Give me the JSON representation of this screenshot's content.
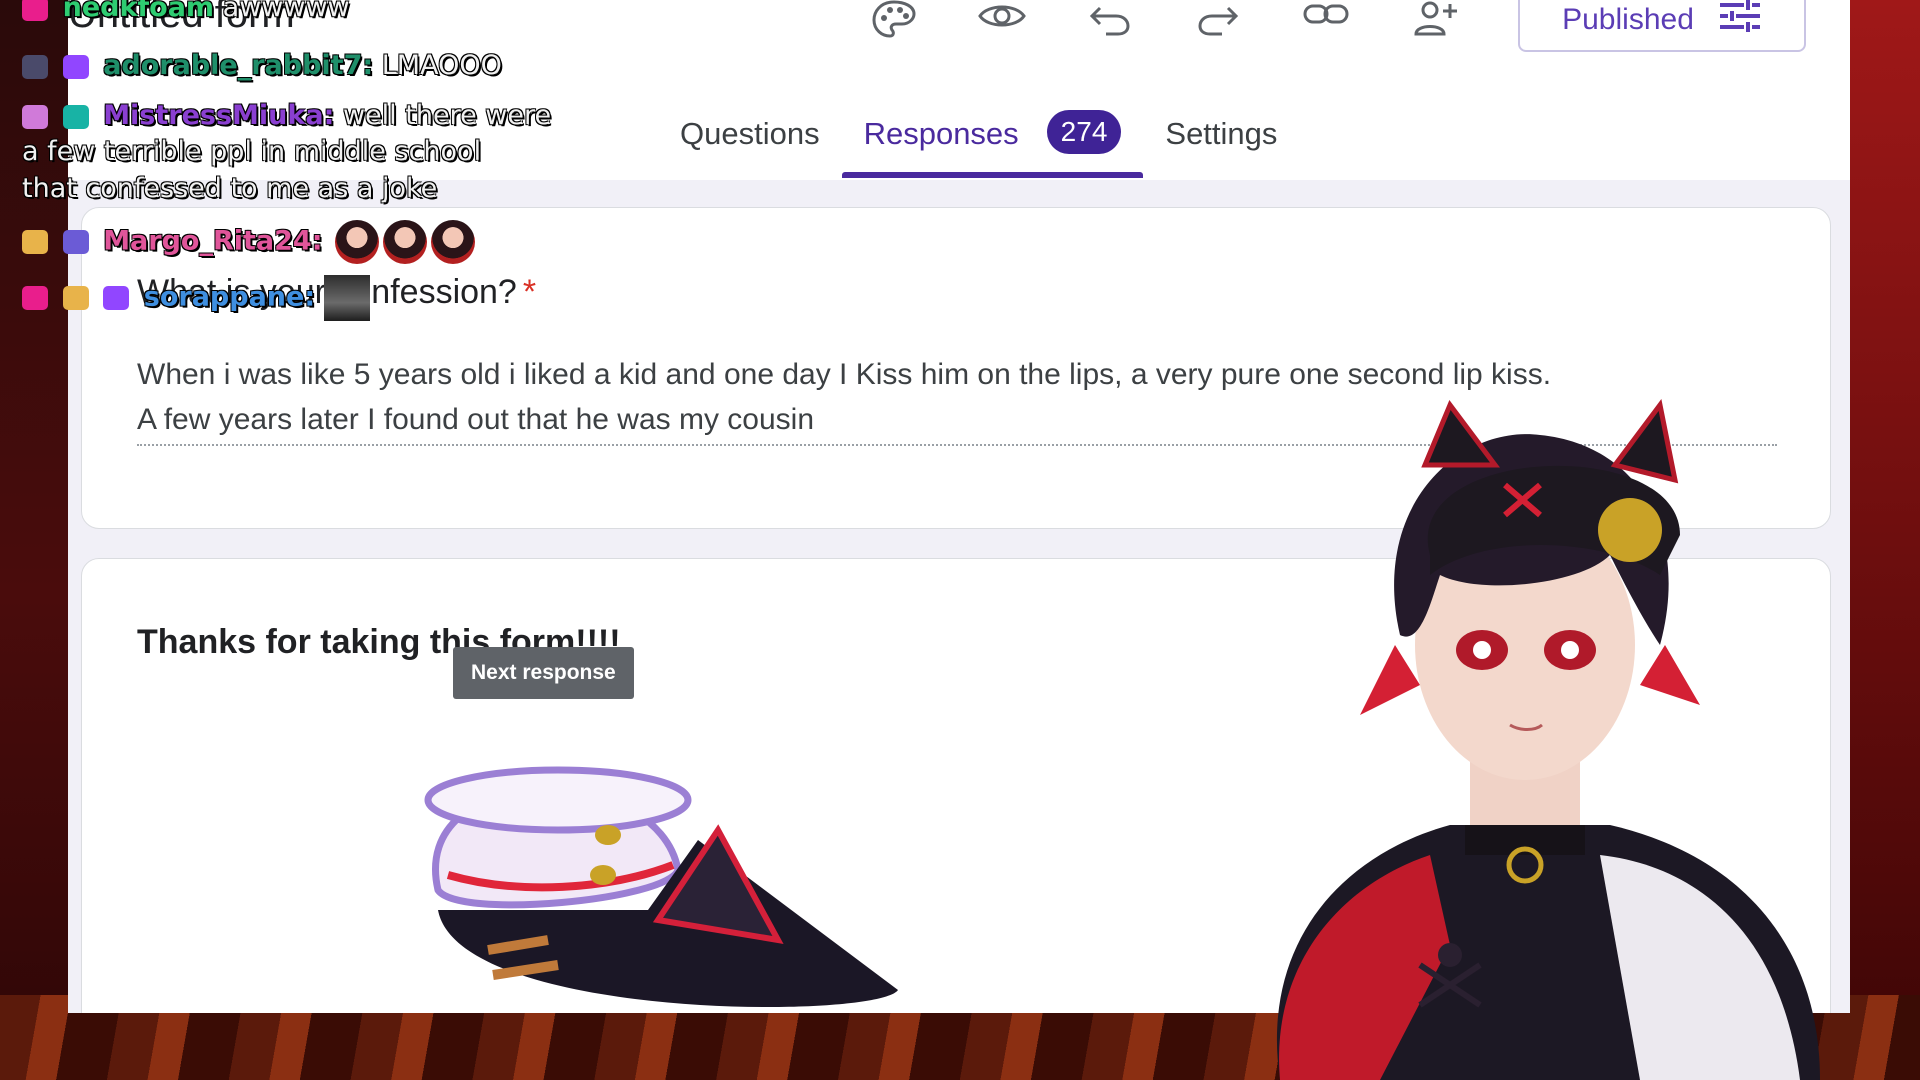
{
  "form": {
    "title": "Untitled form",
    "publish_label": "Published",
    "tabs": [
      {
        "label": "Questions"
      },
      {
        "label": "Responses",
        "badge": "274"
      },
      {
        "label": "Settings"
      }
    ],
    "question": {
      "title": "What is your confession?",
      "required_mark": "*",
      "answer_line1": "When i was like 5 years old i liked a kid and one day I Kiss him on the lips, a very pure one second lip kiss.",
      "answer_line2": "A few years later I found out that he was my cousin"
    },
    "closing_text": "Thanks for taking this form!!!!",
    "tooltip": "Next response"
  },
  "chat": [
    {
      "user": "nedkfoam",
      "message": "awwwww",
      "user_color": "#2ecc71"
    },
    {
      "user": "adorable_rabbit7:",
      "message": "LMAOOO",
      "user_color": "#1f8f6a"
    },
    {
      "user": "MistressMiuka:",
      "message": "well there were",
      "message_cont1": "a few terrible ppl in middle school",
      "message_cont2": "that confessed to me as a joke",
      "user_color": "#8a3fd1"
    },
    {
      "user": "Margo_Rita24:",
      "user_color": "#e0559a"
    },
    {
      "user": "sorappane:",
      "user_color": "#3f8fe0"
    }
  ],
  "colors": {
    "accent": "#4a2a9e",
    "badge_bg": "#3f2396",
    "required": "#d93025"
  },
  "icons": [
    "palette-icon",
    "eye-icon",
    "undo-icon",
    "redo-icon",
    "link-icon",
    "add-collaborator-icon",
    "tune-icon",
    "star-icon",
    "folder-icon"
  ]
}
